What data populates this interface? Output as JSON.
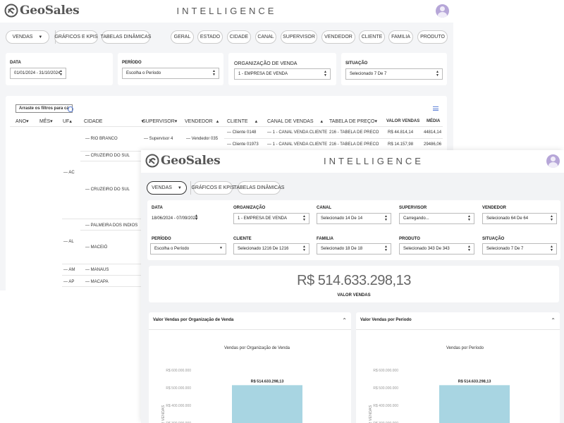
{
  "app": {
    "logo_text": "GeoSales",
    "brand_title": "INTELLIGENCE"
  },
  "colors": {
    "bar": "#a8d5e2",
    "accent": "#5b7fd6",
    "avatar": "#b6a6d8"
  },
  "w1": {
    "nav": {
      "vendas": "VENDAS",
      "graficos": "GRÁFICOS E KPIS",
      "tabelas": "TABELAS DINÂMICAS"
    },
    "groups": [
      "GERAL",
      "ESTADO",
      "CIDADE",
      "CANAL",
      "SUPERVISOR",
      "VENDEDOR",
      "CLIENTE",
      "FAMILIA",
      "PRODUTO"
    ],
    "filters": {
      "data_label": "DATA",
      "data_value": "01/01/2024 - 31/10/2024",
      "periodo_label": "PERÍODO",
      "periodo_value": "Escolha o Período",
      "org_label": "ORGANIZAÇÃO DE VENDA",
      "org_value": "1 - EMPRESA DE VENDA",
      "situacao_label": "SITUAÇÃO",
      "situacao_value": "Selecionado 7 De 7"
    },
    "pivot": {
      "drag_text": "Arraste os filtros para cá",
      "headers": {
        "ano": "ANO",
        "mes": "MÊS",
        "uf": "UF",
        "cidade": "CIDADE",
        "supervisor": "SUPERVISOR",
        "vendedor": "VENDEDOR",
        "cliente": "CLIENTE",
        "canal": "CANAL DE VENDAS",
        "tabela": "TABELA DE PREÇO",
        "valor": "VALOR VENDAS",
        "media": "MÉDIA"
      },
      "uf_values": [
        "AC",
        "AL",
        "AM",
        "AP"
      ],
      "cities": [
        "RIO BRANCO",
        "CRUZEIRO DO SUL",
        "CRUZEIRO DO SUL",
        "PALMEIRA DOS INDIOS",
        "MACEIÓ",
        "MANAUS",
        "MACAPA"
      ],
      "rows": [
        {
          "supervisor": "Supervisor 4",
          "vendedor": "Vendedor 035",
          "cliente": "Cliente 0148",
          "canal": "1 - CANAL VENDA CLIENTE",
          "tabela": "216 - TABELA DE PRECO",
          "valor": "R$ 44.814,14",
          "media": "44814,14"
        },
        {
          "supervisor": "",
          "vendedor": "",
          "cliente": "Cliente 01973",
          "canal": "1 - CANAL VENDA CLIENTE",
          "tabela": "216 - TABELA DE PRECO",
          "valor": "R$ 14.157,98",
          "media": "29486,06"
        }
      ]
    }
  },
  "w2": {
    "nav": {
      "vendas": "VENDAS",
      "graficos": "GRÁFICOS E KPIS",
      "tabelas": "TABELAS DINÂMICAS"
    },
    "filters": {
      "data": {
        "label": "DATA",
        "value": "18/06/2024 - 07/09/2024"
      },
      "organizacao": {
        "label": "ORGANIZAÇÃO",
        "value": "1 - EMPRESA DE VENDA"
      },
      "canal": {
        "label": "CANAL",
        "value": "Selecionado 14 De 14"
      },
      "supervisor": {
        "label": "SUPERVISOR",
        "value": "Carregando..."
      },
      "vendedor": {
        "label": "VENDEDOR",
        "value": "Selecionado 64 De 64"
      },
      "periodo": {
        "label": "PERÍODO",
        "value": "Escolha o Período"
      },
      "cliente": {
        "label": "CLIENTE",
        "value": "Selecionado 1216 De 1216"
      },
      "familia": {
        "label": "FAMILIA",
        "value": "Selecionado 18 De 18"
      },
      "produto": {
        "label": "PRODUTO",
        "value": "Selecionado 343 De 343"
      },
      "situacao": {
        "label": "SITUAÇÃO",
        "value": "Selecionado 7 De 7"
      }
    },
    "kpi": {
      "value": "R$ 514.633.298,13",
      "label": "VALOR VENDAS"
    },
    "panel1": {
      "title": "Valor Vendas por Organização de Venda"
    },
    "panel2": {
      "title": "Valor Vendas por Período"
    }
  },
  "chart_data": [
    {
      "type": "bar",
      "title": "Vendas por Organização de Venda",
      "ylabel": "VALOR VENDAS",
      "yticks": [
        "R$ 600.000.000",
        "R$ 500.000.000",
        "R$ 400.000.000",
        "R$ 300.000.000"
      ],
      "ylim": [
        0,
        600000000
      ],
      "categories": [
        "1 - EMPRESA DE VENDA"
      ],
      "values": [
        514633298.13
      ],
      "data_labels": [
        "R$ 514.633.298,13"
      ]
    },
    {
      "type": "bar",
      "title": "Vendas por Período",
      "ylabel": "VALOR VENDAS",
      "yticks": [
        "R$ 600.000.000",
        "R$ 500.000.000",
        "R$ 400.000.000",
        "R$ 300.000.000"
      ],
      "ylim": [
        0,
        600000000
      ],
      "categories": [
        ""
      ],
      "values": [
        514633298.13
      ],
      "data_labels": [
        "R$ 514.633.298,13"
      ]
    }
  ]
}
